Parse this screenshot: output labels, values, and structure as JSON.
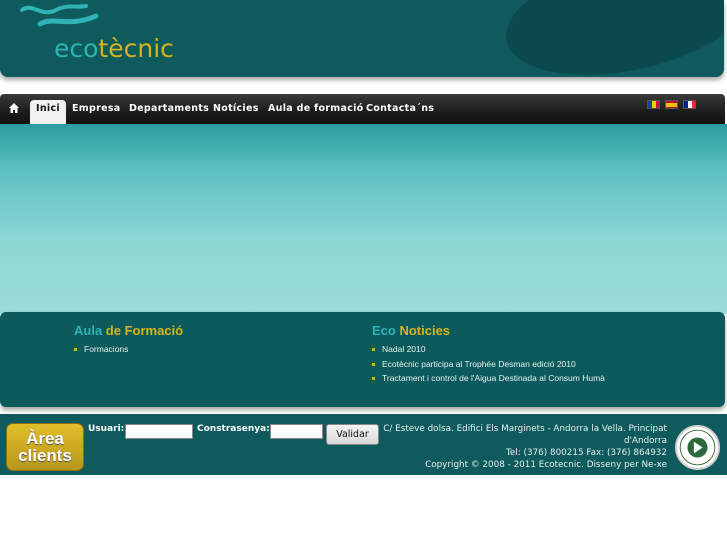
{
  "header": {
    "logo_part1": "eco",
    "logo_part2": "tècnic"
  },
  "nav": {
    "home_icon": "home-icon",
    "items": [
      {
        "label": "Inici",
        "active": true
      },
      {
        "label": "Empresa"
      },
      {
        "label": "Departaments"
      },
      {
        "label": "Notícies"
      },
      {
        "label": "Aula de formació"
      },
      {
        "label": "Contacta´ns"
      }
    ],
    "flags": [
      "flag-andorra-icon",
      "flag-spain-icon",
      "flag-france-icon"
    ]
  },
  "boxes": {
    "aula": {
      "title_part1": "Aula",
      "title_part2": "de Formació",
      "items": [
        "Formacions"
      ]
    },
    "noticies": {
      "title_part1": "Eco",
      "title_part2": "Noticies",
      "items": [
        "Nadal 2010",
        "Ecotècnic participa al Trophée Desman edició 2010",
        "Tractament i control de l'Aigua Destinada al Consum Humà"
      ]
    }
  },
  "footer": {
    "area_clients_line1": "Àrea",
    "area_clients_line2": "clients",
    "user_label": "Usuari:",
    "password_label": "Constrasenya:",
    "validate_label": "Validar",
    "address_line1": "C/ Esteve dolsa. Edifici Els Marginets - Andorra la Vella. Principat d'Andorra",
    "address_line2": "Tel: (376) 800215 Fax: (376) 864932",
    "address_line3": "Copyright © 2008 - 2011 Ecotecnic. Disseny per Ne-xe"
  },
  "colors": {
    "brand_teal": "#0e5a5c",
    "logo_cyan": "#2fb3b4",
    "logo_gold": "#d6b51a"
  }
}
